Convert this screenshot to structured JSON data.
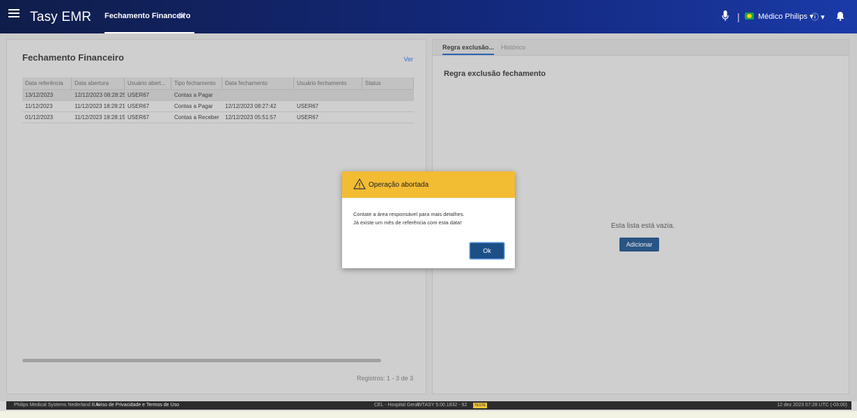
{
  "header": {
    "app_title": "Tasy EMR",
    "tab_label": "Fechamento Financeiro",
    "tab_close": "✕",
    "user_menu": "Médico Philips ▾",
    "info_menu": "ⓘ ▾",
    "divider": "|",
    "icons": [
      "menu-icon",
      "microphone-icon",
      "flag-icon",
      "info-icon",
      "bell-icon"
    ]
  },
  "left_panel": {
    "title": "Fechamento Financeiro",
    "ver_link": "Ver",
    "columns": [
      "Data referência",
      "Data abertura",
      "Usuário abert...",
      "Tipo fechamento",
      "Data fechamento",
      "Usuário fechamento",
      "Status"
    ],
    "rows": [
      [
        "13/12/2023",
        "12/12/2023 08:28:25",
        "USER67",
        "Contas a Pagar",
        "",
        "",
        ""
      ],
      [
        "11/12/2023",
        "11/12/2023 18:28:21",
        "USER67",
        "Contas a Pagar",
        "12/12/2023 08:27:42",
        "USER67",
        ""
      ],
      [
        "01/12/2023",
        "11/12/2023 18:28:15",
        "USER67",
        "Contas a Receber",
        "12/12/2023 05:51:57",
        "USER67",
        ""
      ]
    ],
    "registros": "Registros: 1 - 3 de 3"
  },
  "right_panel": {
    "tabs": [
      "Regra exclusão...",
      "Histórico"
    ],
    "title": "Regra exclusão fechamento",
    "empty_message": "Esta lista está vazia.",
    "add_button": "Adicionar"
  },
  "dialog": {
    "title": "Operação abortada",
    "line1": "Contate a área responsável para mais detalhes.",
    "line2": "Já existe um mês de referência com esta data!",
    "ok_button": "Ok",
    "header_color": "#f2bc33"
  },
  "footer": {
    "company": "Philips Medical Systems Nederland B.V.",
    "privacy": "Aviso de Privacidade e Termos de Uso",
    "hospital": "CEL - Hospital Geral",
    "version": "WTASY 5.00.1832 - 92",
    "badge": "TESTE",
    "datetime": "12 dez 2023 07:28 UTC (-03:00)"
  },
  "colors": {
    "header_gradient_start": "#0f1d4a",
    "header_gradient_end": "#1a3aa8",
    "primary_button": "#1c4f86",
    "link": "#2a6fd6"
  }
}
